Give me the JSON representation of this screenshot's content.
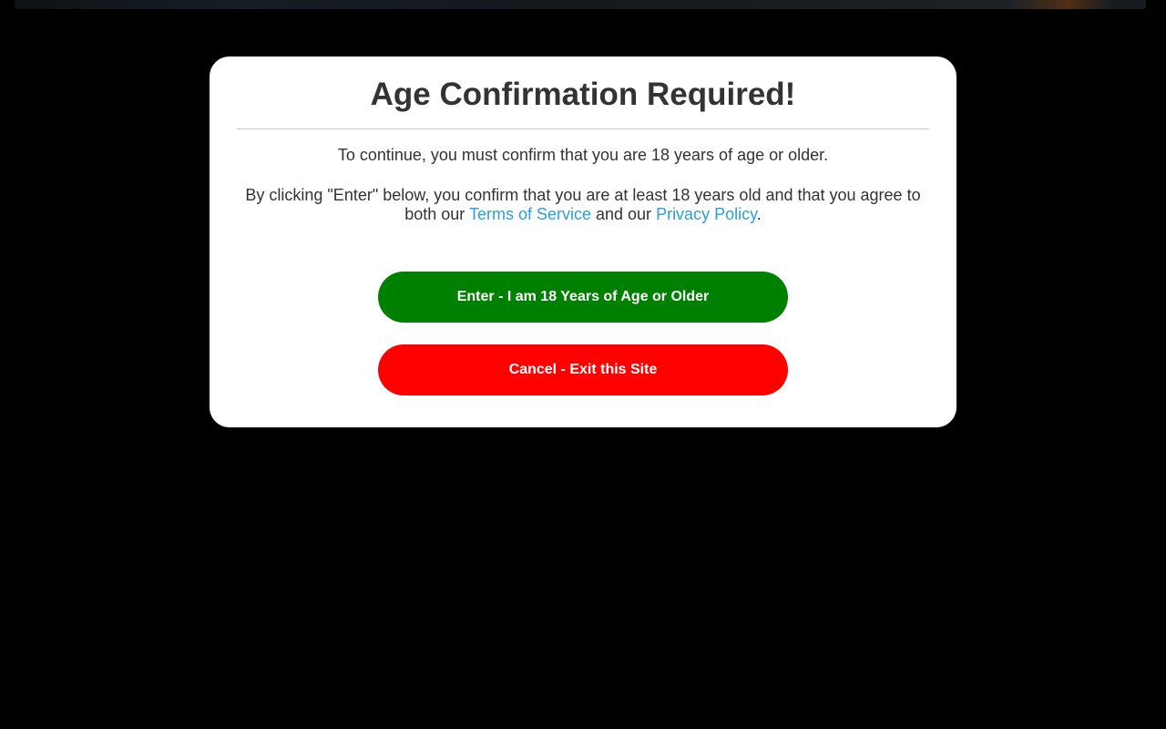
{
  "modal": {
    "title": "Age Confirmation Required!",
    "line1": "To continue, you must confirm that you are 18 years of age or older.",
    "line2_prefix": "By clicking \"Enter\" below, you confirm that you are at least 18 years old and that you agree to both our ",
    "terms_link": "Terms of Service",
    "line2_mid": " and our ",
    "privacy_link": "Privacy Policy",
    "line2_suffix": ".",
    "enter_label": "Enter - I am 18 Years of Age or Older",
    "cancel_label": "Cancel - Exit this Site"
  },
  "colors": {
    "enter": "#008000",
    "cancel": "#ff0000",
    "link": "#2a9fd8",
    "text": "#333333",
    "backdrop": "#000000"
  }
}
